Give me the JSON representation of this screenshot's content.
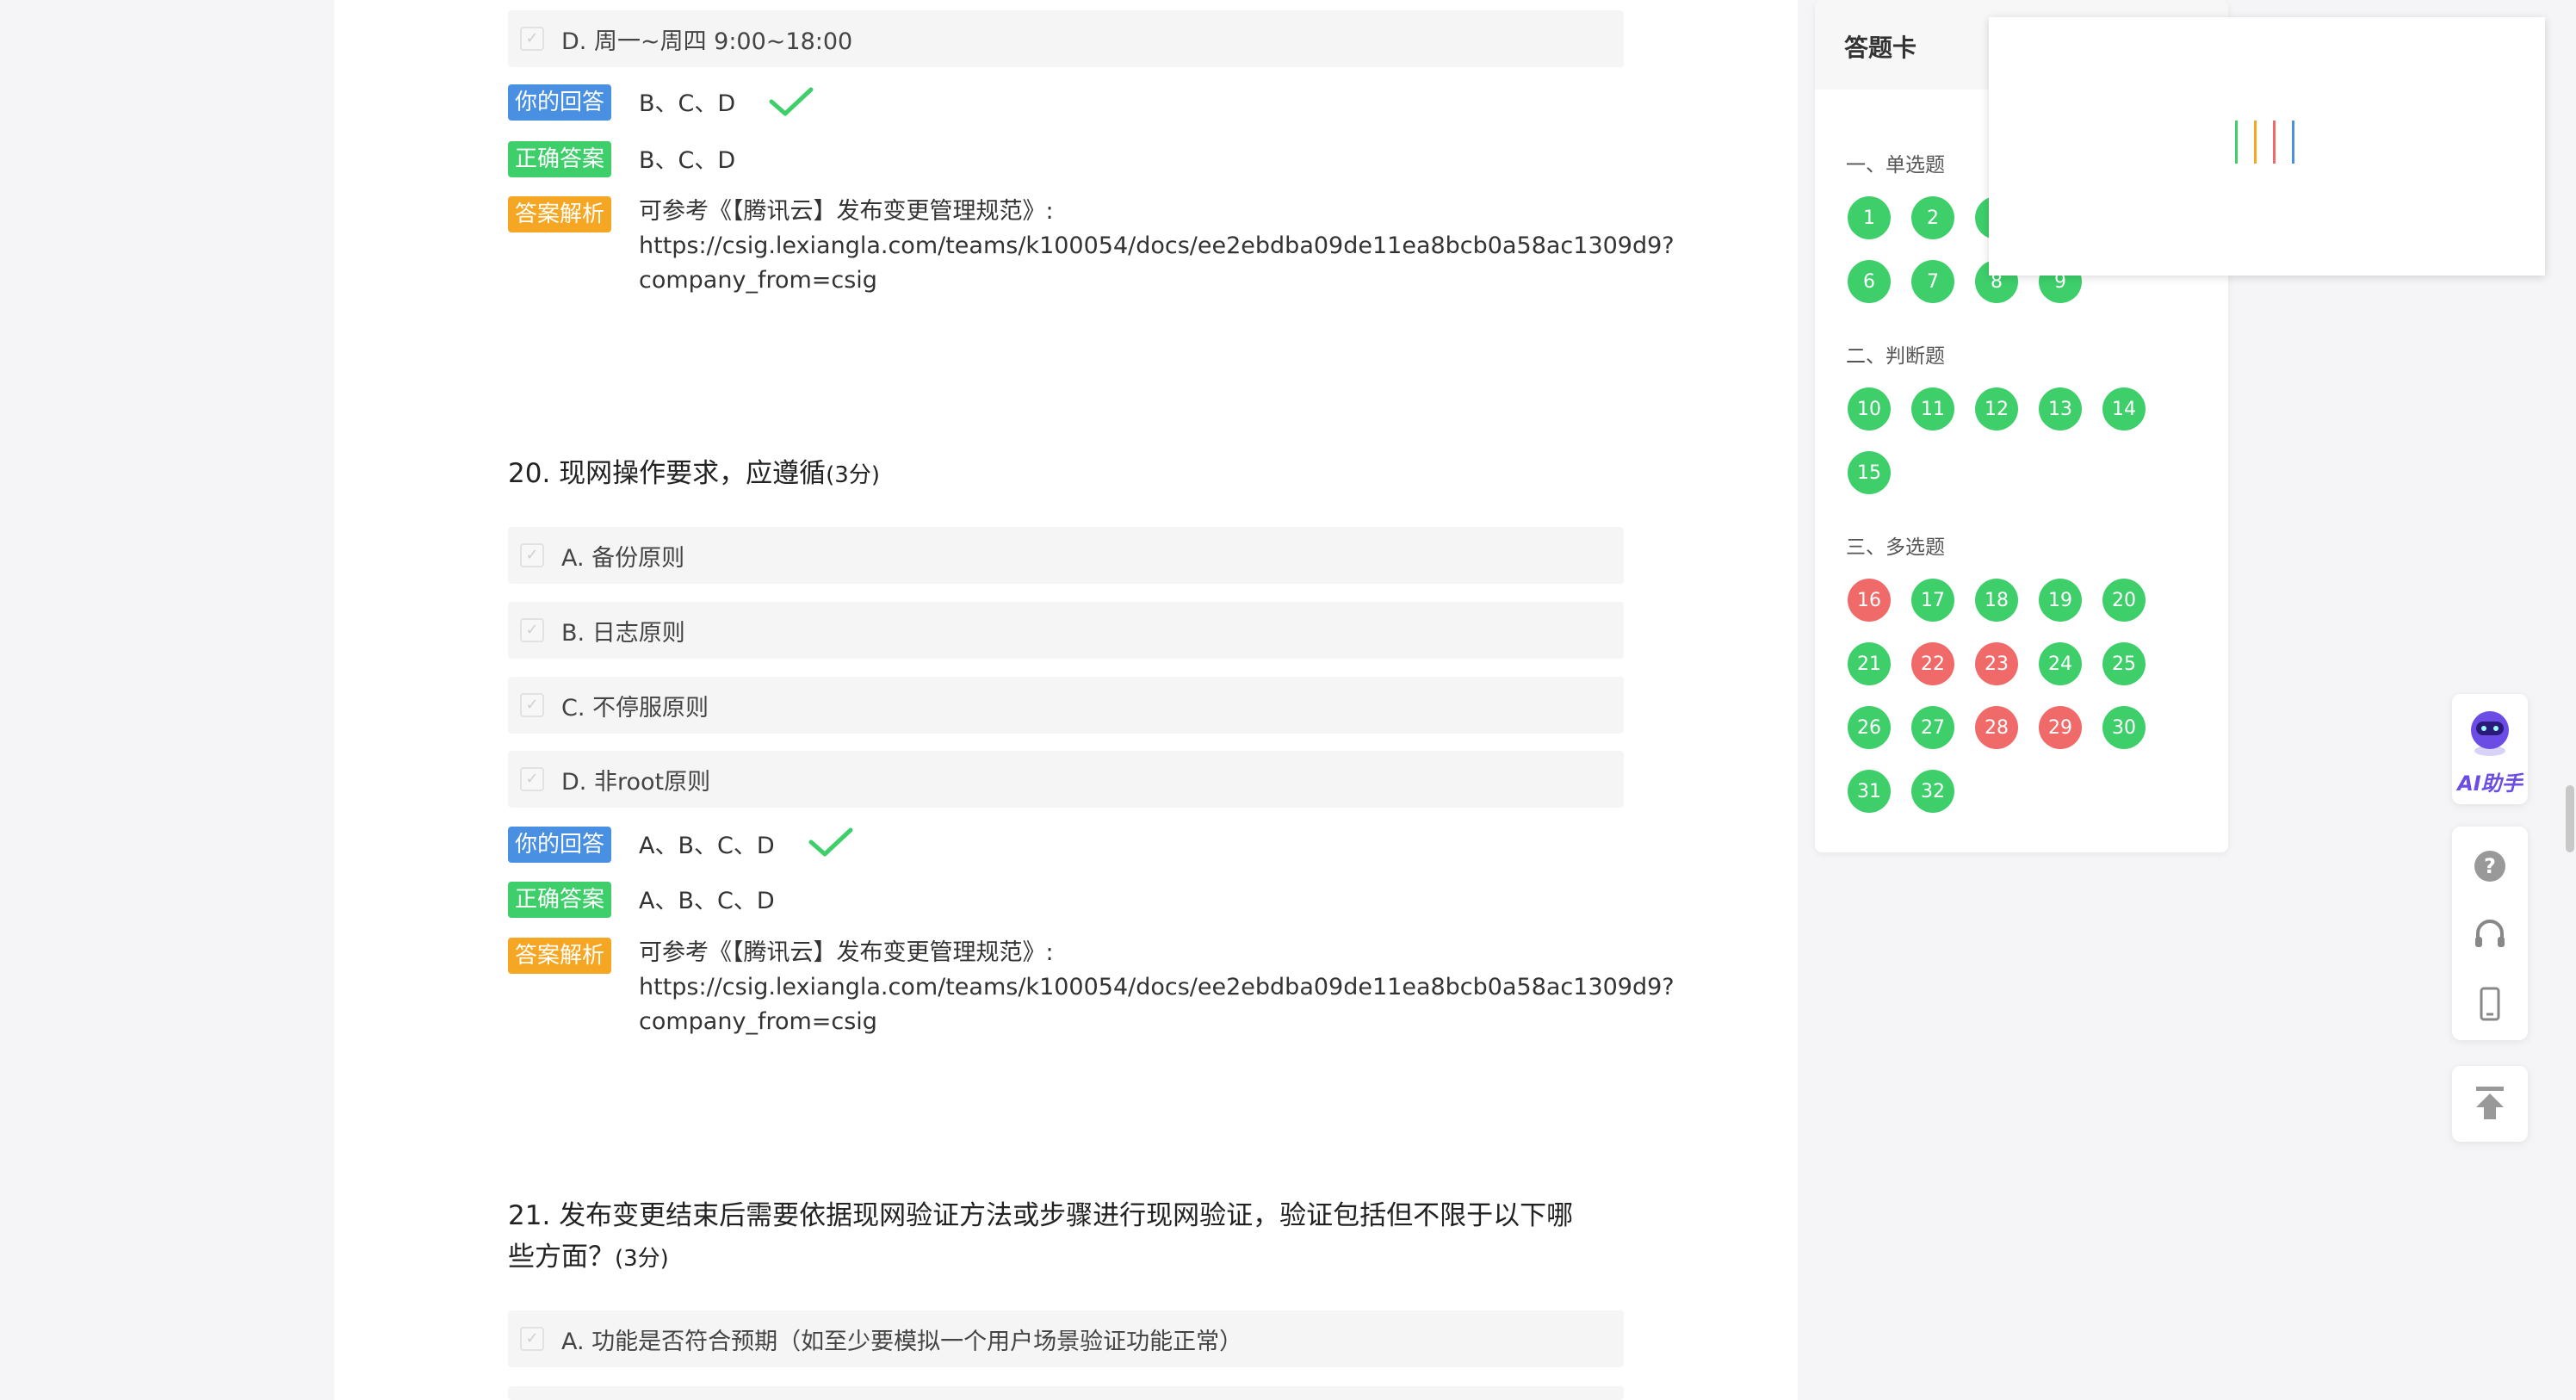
{
  "q19": {
    "option_d": "D. 周一~周四 9:00~18:00",
    "your_answer_label": "你的回答",
    "your_answer": "B、C、D",
    "correct_label": "正确答案",
    "correct_answer": "B、C、D",
    "analysis_label": "答案解析",
    "analysis_line1": "可参考《【腾讯云】发布变更管理规范》:",
    "analysis_line2": "https://csig.lexiangla.com/teams/k100054/docs/ee2ebdba09de11ea8bcb0a58ac1309d9?",
    "analysis_line3": "company_from=csig"
  },
  "q20": {
    "title": "20. 现网操作要求，应遵循",
    "score": "(3分)",
    "options": [
      "A. 备份原则",
      "B. 日志原则",
      "C. 不停服原则",
      "D. 非root原则"
    ],
    "your_answer_label": "你的回答",
    "your_answer": "A、B、C、D",
    "correct_label": "正确答案",
    "correct_answer": "A、B、C、D",
    "analysis_label": "答案解析",
    "analysis_line1": "可参考《【腾讯云】发布变更管理规范》:",
    "analysis_line2": "https://csig.lexiangla.com/teams/k100054/docs/ee2ebdba09de11ea8bcb0a58ac1309d9?",
    "analysis_line3": "company_from=csig"
  },
  "q21": {
    "title_line1": "21. 发布变更结束后需要依据现网验证方法或步骤进行现网验证，验证包括但不限于以下哪",
    "title_line2": "些方面？",
    "score": "(3分)",
    "option_a": "A. 功能是否符合预期（如至少要模拟一个用户场景验证功能正常）"
  },
  "answer_card": {
    "title": "答题卡",
    "sections": [
      {
        "label": "一、单选题",
        "items": [
          {
            "n": "1",
            "ok": true
          },
          {
            "n": "2",
            "ok": true
          },
          {
            "n": "3",
            "ok": true
          },
          {
            "n": "6",
            "ok": true
          },
          {
            "n": "7",
            "ok": true
          },
          {
            "n": "8",
            "ok": true
          },
          {
            "n": "9",
            "ok": true
          }
        ]
      },
      {
        "label": "二、判断题",
        "items": [
          {
            "n": "10",
            "ok": true
          },
          {
            "n": "11",
            "ok": true
          },
          {
            "n": "12",
            "ok": true
          },
          {
            "n": "13",
            "ok": true
          },
          {
            "n": "14",
            "ok": true
          },
          {
            "n": "15",
            "ok": true
          }
        ]
      },
      {
        "label": "三、多选题",
        "items": [
          {
            "n": "16",
            "ok": false
          },
          {
            "n": "17",
            "ok": true
          },
          {
            "n": "18",
            "ok": true
          },
          {
            "n": "19",
            "ok": true
          },
          {
            "n": "20",
            "ok": true
          },
          {
            "n": "21",
            "ok": true
          },
          {
            "n": "22",
            "ok": false
          },
          {
            "n": "23",
            "ok": false
          },
          {
            "n": "24",
            "ok": true
          },
          {
            "n": "25",
            "ok": true
          },
          {
            "n": "26",
            "ok": true
          },
          {
            "n": "27",
            "ok": true
          },
          {
            "n": "28",
            "ok": false
          },
          {
            "n": "29",
            "ok": false
          },
          {
            "n": "30",
            "ok": true
          },
          {
            "n": "31",
            "ok": true
          },
          {
            "n": "32",
            "ok": true
          }
        ]
      }
    ]
  },
  "float_tools": {
    "ai_label": "AI助手",
    "icons": [
      "help-icon",
      "headset-icon",
      "mobile-icon",
      "back-to-top-icon"
    ]
  },
  "colors": {
    "correct": "#3ecf6b",
    "wrong": "#f06a6a",
    "your_answer_tag": "#4a90e2",
    "analysis_tag": "#f5a623"
  }
}
